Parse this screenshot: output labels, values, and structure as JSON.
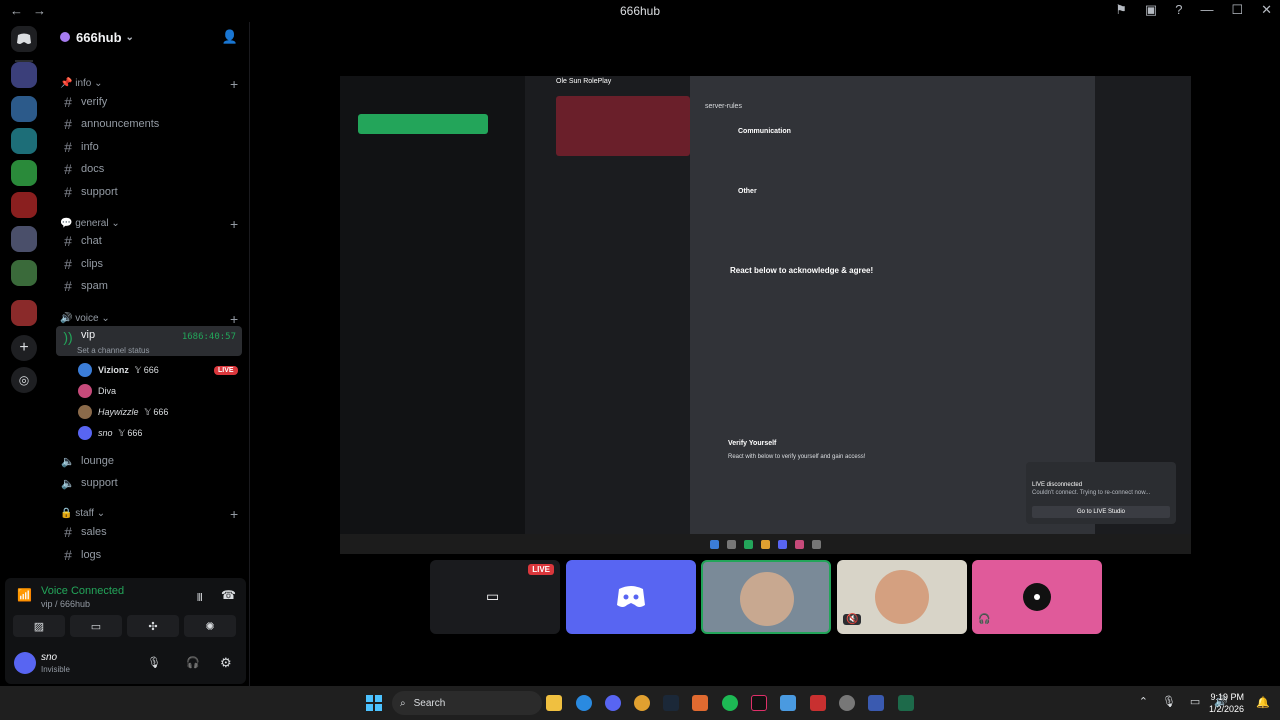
{
  "window": {
    "title": "666hub"
  },
  "guild": {
    "name": "666hub"
  },
  "channels": {
    "info_category": "info",
    "info_items": [
      "verify",
      "announcements",
      "info",
      "docs",
      "support"
    ],
    "general_category": "general",
    "general_items": [
      "chat",
      "clips",
      "spam"
    ],
    "voice_category": "voice",
    "vip_channel": "vip",
    "vip_timer": "1686:40:57",
    "vip_status_hint": "Set a channel status",
    "vip_members": [
      {
        "name": "Vizionz",
        "tag": "666",
        "live": "LIVE"
      },
      {
        "name": "Diva",
        "tag": "",
        "live": ""
      },
      {
        "name": "Haywizzle",
        "tag": "666",
        "live": ""
      },
      {
        "name": "sno",
        "tag": "666",
        "live": ""
      }
    ],
    "voice_items": [
      "lounge",
      "support"
    ],
    "staff_category": "staff",
    "staff_items": [
      "sales",
      "logs"
    ]
  },
  "voice_panel": {
    "title": "Voice Connected",
    "subtitle": "vip / 666hub"
  },
  "user": {
    "name": "sno",
    "status": "Invisible"
  },
  "stream": {
    "inner_title": "Ole Sun RolePlay",
    "inner_channel": "server-rules",
    "communication_heading": "Communication",
    "other_heading": "Other",
    "react_heading": "React below to acknowledge & agree!",
    "verify_heading": "Verify Yourself",
    "verify_text": "React with below to verify yourself and gain access!",
    "tiktok_title": "LIVE disconnected",
    "tiktok_body": "Couldn't connect. Trying to re-connect now...",
    "tiktok_button": "Go to LIVE Studio"
  },
  "tiles": {
    "live_label": "LIVE"
  },
  "taskbar": {
    "search_placeholder": "Search",
    "time": "9:19 PM",
    "date": "1/2/2026"
  }
}
